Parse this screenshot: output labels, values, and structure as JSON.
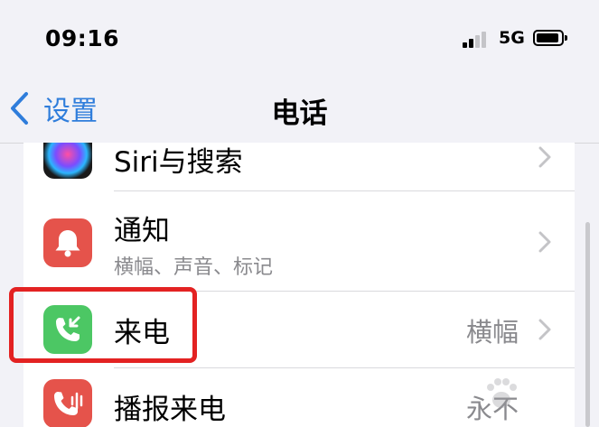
{
  "status_bar": {
    "time": "09:16",
    "network": "5G",
    "signal_bars": 2,
    "signal_bars_total": 4
  },
  "nav": {
    "back_label": "设置",
    "title": "电话"
  },
  "rows": [
    {
      "label": "Siri与搜索",
      "icon": "siri-icon",
      "icon_color": "#1a1a1a"
    },
    {
      "label": "通知",
      "sublabel": "横幅、声音、标记",
      "icon": "bell-icon",
      "icon_color": "#e5534b"
    },
    {
      "label": "来电",
      "value": "横幅",
      "icon": "incoming-call-icon",
      "icon_color": "#4cc764",
      "highlighted": true
    },
    {
      "label": "播报来电",
      "value": "永不",
      "icon": "announce-call-icon",
      "icon_color": "#e5534b"
    }
  ],
  "colors": {
    "accent": "#2f7ddb",
    "highlight": "#e32222"
  }
}
